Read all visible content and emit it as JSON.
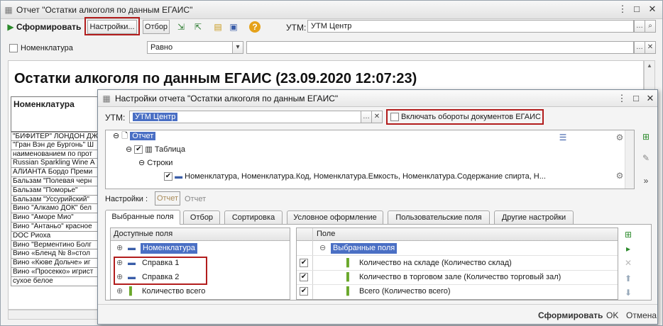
{
  "main": {
    "title": "Отчет \"Остатки алкоголя по данным ЕГАИС\"",
    "toolbar": {
      "generate": "Сформировать",
      "settings": "Настройки...",
      "filter": "Отбор"
    },
    "utm_label": "УТМ:",
    "utm_value": "УТМ Центр",
    "nomen_label": "Номенклатура",
    "condition": "Равно",
    "report_title": "Остатки алкоголя по данным ЕГАИС (23.09.2020 12:07:23)",
    "column_header": "Номенклатура",
    "rows": [
      "\"БИФИТЕР\" ЛОНДОН ДЖ",
      "\"Гран Вэн де Бургонь\" Ш",
      "наименованием по прот",
      "Russian Sparkling Wine А",
      "АЛИАНТА Бордо Преми",
      "Бальзам \"Полевая черн",
      "Бальзам \"Поморье\"",
      "Бальзам \"Уссурийский\"",
      "Вино \"Алкамо ДОК\" бел",
      "Вино \"Аморе Мио\"",
      "Вино \"Антаньо\" красное",
      "DOC Риоха",
      "Вино \"Верментино Болг",
      "Вино «Бленд № 8»стол",
      "Вино «Кюве Дольче» иг",
      "Вино «Просекко» игрист",
      "сухое белое"
    ]
  },
  "dialog": {
    "title": "Настройки отчета \"Остатки алкоголя по данным ЕГАИС\"",
    "utm_label": "УТМ:",
    "utm_value": "УТМ Центр",
    "include_label": "Включать обороты документов ЕГАИС",
    "tree": {
      "report": "Отчет",
      "table": "Таблица",
      "rows": "Строки",
      "fields": "Номенклатура, Номенклатура.Код, Номенклатура.Емкость, Номенклатура.Содержание спирта, Н..."
    },
    "settings_label": "Настройки :",
    "settings_option1": "Отчет",
    "settings_option2": "Отчет",
    "tabs": [
      "Выбранные поля",
      "Отбор",
      "Сортировка",
      "Условное оформление",
      "Пользовательские поля",
      "Другие настройки"
    ],
    "available_header": "Доступные поля",
    "available": [
      "Номенклатура",
      "Справка 1",
      "Справка 2",
      "Количество всего"
    ],
    "field_header": "Поле",
    "selected_root": "Выбранные поля",
    "selected": [
      "Количество на складе (Количество склад)",
      "Количество в торговом зале (Количество торговый зал)",
      "Всего (Количество всего)"
    ],
    "footer": {
      "generate": "Сформировать",
      "ok": "OK",
      "cancel": "Отмена"
    }
  },
  "colors": {
    "highlight": "#4a6fc4",
    "red_frame": "#b21d1d"
  }
}
